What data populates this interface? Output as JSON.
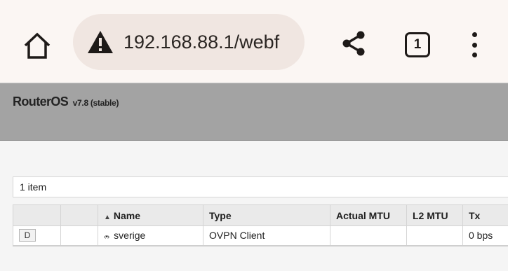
{
  "browser": {
    "url": "192.168.88.1/webf",
    "tab_count": "1",
    "icons": [
      "home-icon",
      "warning-icon",
      "share-icon",
      "tabs-icon",
      "more-vert-icon"
    ]
  },
  "router": {
    "product": "RouterOS",
    "version": "v7.8 (stable)"
  },
  "list": {
    "item_count": "1 item",
    "columns": [
      "",
      "",
      "Name",
      "Type",
      "Actual MTU",
      "L2 MTU",
      "Tx"
    ],
    "sort_indicator": "▲",
    "rows": [
      {
        "flag": "D",
        "name_icon": "‹•›",
        "name": "sverige",
        "type": "OVPN Client",
        "actual_mtu": "",
        "l2_mtu": "",
        "tx": "0 bps"
      }
    ]
  },
  "colors": {
    "browser_bar": "#fbf6f3",
    "url_pill": "#f0e6e1",
    "header_gray": "#a3a3a3",
    "content_bg": "#f5f5f5"
  }
}
